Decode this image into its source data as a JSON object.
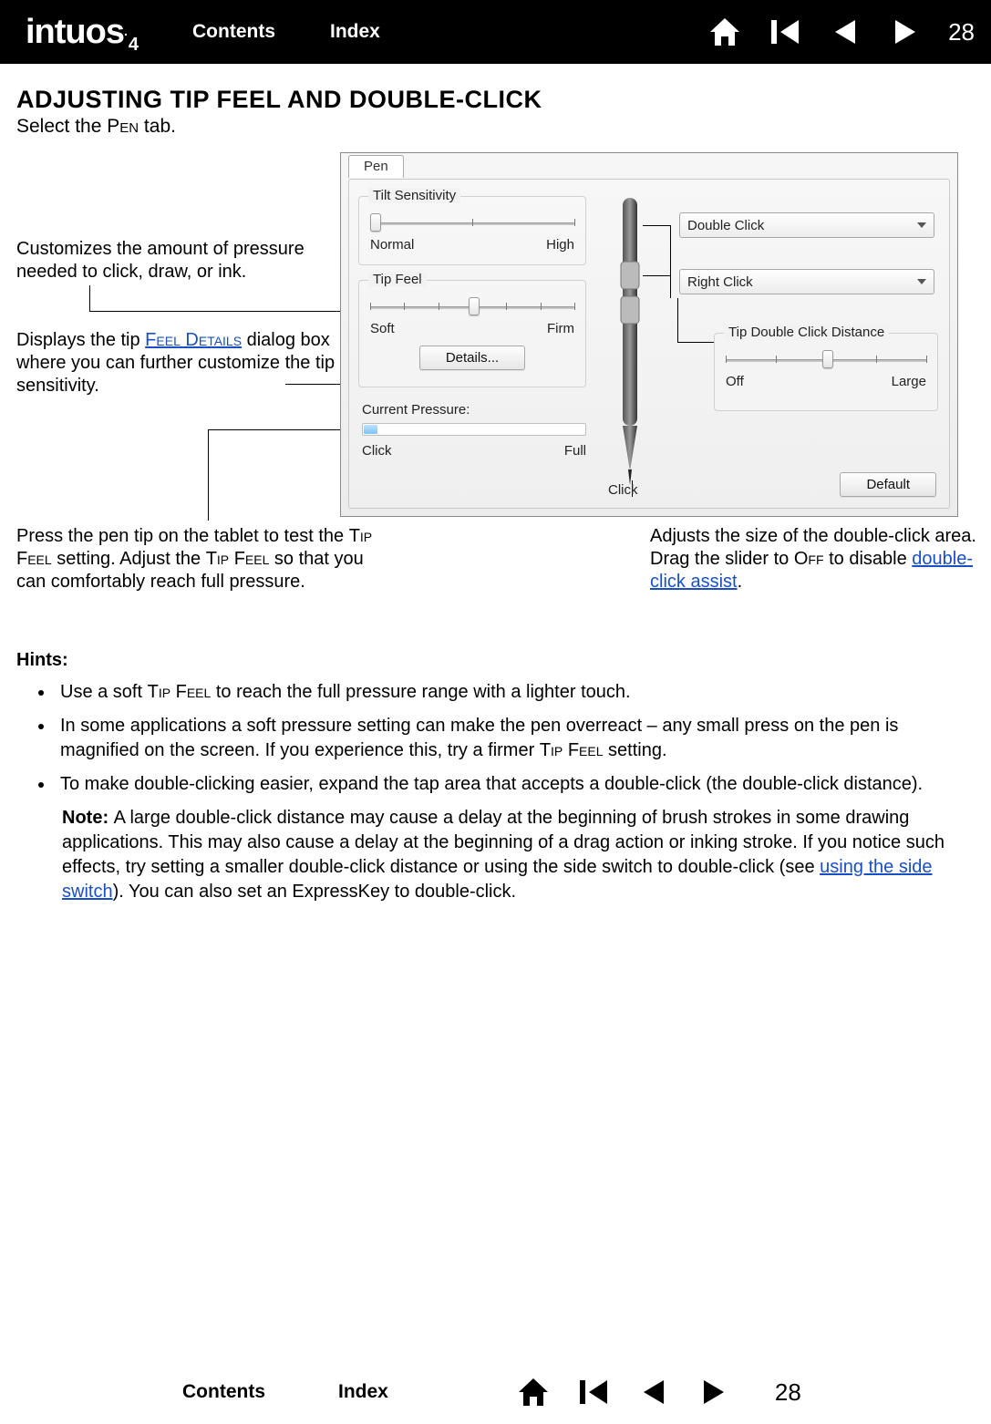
{
  "nav": {
    "logo": "intuos",
    "logo_sub": "4",
    "contents": "Contents",
    "index": "Index",
    "page": "28"
  },
  "heading": "ADJUSTING TIP FEEL AND DOUBLE-CLICK",
  "subheading_pre": "Select the ",
  "subheading_sc": "Pen",
  "subheading_post": " tab.",
  "callouts": {
    "c1": "Customizes the amount of pressure needed to click, draw, or ink.",
    "c2_pre": "Displays the tip ",
    "c2_link": "Feel Details",
    "c2_post": " dialog box where you can further customize the tip sensitivity.",
    "c3_pre": "Press the pen tip on the tablet to test the ",
    "c3_sc1": "Tip Feel",
    "c3_mid": " setting.  Adjust the ",
    "c3_sc2": "Tip Feel",
    "c3_post": " so that you can comfortably reach full pressure.",
    "c4_pre": "Adjusts the size of the double-click area.  Drag the slider to ",
    "c4_sc": "Off",
    "c4_mid": " to disable ",
    "c4_link": "double-click assist",
    "c4_post": "."
  },
  "panel": {
    "tab": "Pen",
    "tilt_title": "Tilt Sensitivity",
    "tilt_left": "Normal",
    "tilt_right": "High",
    "tip_title": "Tip Feel",
    "tip_left": "Soft",
    "tip_right": "Firm",
    "details_btn": "Details...",
    "cur_pressure": "Current Pressure:",
    "cp_left": "Click",
    "cp_right": "Full",
    "click_label": "Click",
    "dd_double": "Double Click",
    "dd_right": "Right Click",
    "tdc_title": "Tip Double Click Distance",
    "tdc_left": "Off",
    "tdc_right": "Large",
    "default_btn": "Default"
  },
  "hints": {
    "title": "Hints:",
    "h1_pre": "Use a soft ",
    "h1_sc": "Tip Feel",
    "h1_post": " to reach the full pressure range with a lighter touch.",
    "h2_pre": "In some applications a soft pressure setting can make the pen overreact – any small press on the pen is magnified on the screen.  If you experience this, try a firmer ",
    "h2_sc": "Tip Feel",
    "h2_post": " setting.",
    "h3": "To make double-clicking easier, expand the tap area that accepts a double-click (the double-click distance).",
    "note_label": "Note: ",
    "note_pre": "A large double-click distance may cause a delay at the beginning of brush strokes in some drawing applications.  This may also cause a delay at the beginning of a drag action or inking stroke.  If you notice such effects, try setting a smaller double-click distance or using the side switch to double-click (see ",
    "note_link": "using the side switch",
    "note_post": ").  You can also set an ExpressKey to double-click."
  }
}
